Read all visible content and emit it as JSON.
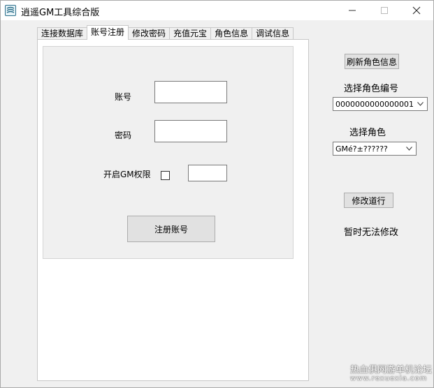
{
  "window": {
    "title": "逍遥GM工具综合版"
  },
  "tabs": [
    {
      "label": "连接数据库",
      "active": false
    },
    {
      "label": "账号注册",
      "active": true
    },
    {
      "label": "修改密码",
      "active": false
    },
    {
      "label": "充值元宝",
      "active": false
    },
    {
      "label": "角色信息",
      "active": false
    },
    {
      "label": "调试信息",
      "active": false
    }
  ],
  "register": {
    "account_label": "账号",
    "account_value": "",
    "password_label": "密码",
    "password_value": "",
    "gm_label": "开启GM权限",
    "gm_checked": false,
    "gm_level_value": "",
    "register_button": "注册账号"
  },
  "right_panel": {
    "refresh_button": "刷新角色信息",
    "select_role_id_label": "选择角色编号",
    "role_id_value": "0000000000000001",
    "select_role_label": "选择角色",
    "role_value": "GMé?±??????",
    "modify_button": "修改道行",
    "status_text": "暂时无法修改"
  },
  "watermark": {
    "text": "热血俱网游单机论坛",
    "url": "www.rexuexia.com"
  }
}
